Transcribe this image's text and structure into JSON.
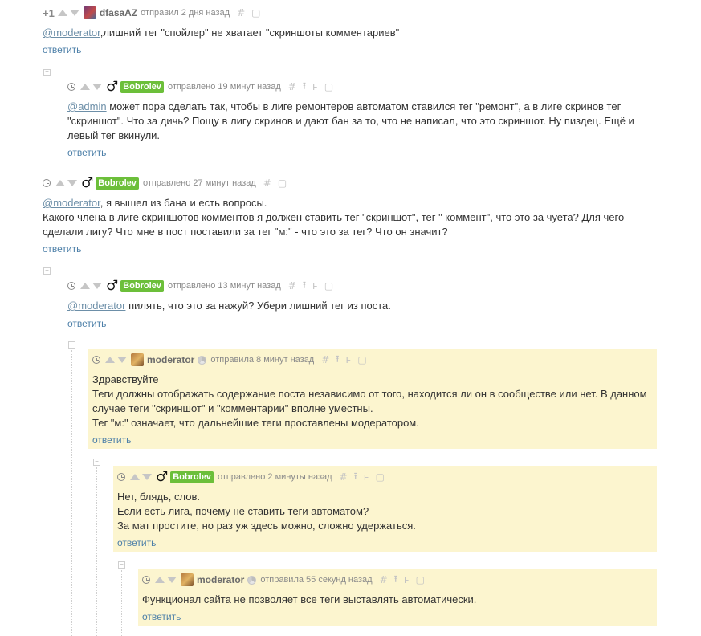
{
  "comments": [
    {
      "rating": "+1",
      "author": "dfasaAZ",
      "time": "отправил 2 дня назад",
      "icons": [
        "#",
        "▢"
      ],
      "mention": "@moderator",
      "lines": [
        ",лишний тег \"спойлер\" не хватает \"скриншоты комментариев\""
      ],
      "reply": "ответить"
    },
    {
      "author": "Bobrolev",
      "time": "отправлено 19 минут назад",
      "icons": [
        "#",
        "⭱",
        "ⱶ",
        "▢"
      ],
      "mention": "@admin",
      "lines": [
        " может пора сделать так, чтобы в лиге ремонтеров автоматом ставился тег \"ремонт\", а в лиге скринов тег",
        "\"скриншот\". Что за дичь? Пощу в лигу скринов и дают бан за то, что не написал, что это скриншот. Ну пиздец. Ещё и",
        "левый тег вкинули."
      ],
      "reply": "ответить"
    },
    {
      "author": "Bobrolev",
      "time": "отправлено 27 минут назад",
      "icons": [
        "#",
        "▢"
      ],
      "mention": "@moderator",
      "lines": [
        ", я вышел из бана и есть вопросы.",
        "Какого члена в лиге скриншотов комментов я должен ставить тег \"скриншот\", тег \" коммент\", что это за чуета? Для чего",
        "сделали лигу? Что мне в пост поставили за тег \"м:\" - что это за тег? Что он значит?"
      ],
      "reply": "ответить"
    },
    {
      "author": "Bobrolev",
      "time": "отправлено 13 минут назад",
      "icons": [
        "#",
        "⭱",
        "ⱶ",
        "▢"
      ],
      "mention": "@moderator",
      "lines": [
        " пилять, что это за нажуй? Убери лишний тег из поста."
      ],
      "reply": "ответить"
    },
    {
      "author": "moderator",
      "time": "отправила 8 минут назад",
      "icons": [
        "#",
        "⭱",
        "ⱶ",
        "▢"
      ],
      "lines": [
        "Здравствуйте",
        "Теги должны отображать содержание поста независимо от того, находится ли он в сообществе или нет. В данном",
        "случае теги \"скриншот\" и \"комментарии\" вполне уместны.",
        "Тег \"м:\" означает, что дальнейшие теги проставлены модератором."
      ],
      "reply": "ответить"
    },
    {
      "author": "Bobrolev",
      "time": "отправлено 2 минуты назад",
      "icons": [
        "#",
        "⭱",
        "ⱶ",
        "▢"
      ],
      "lines": [
        "Нет, блядь, слов.",
        "Если есть лига, почему не ставить теги автоматом?",
        "За мат простите, но раз уж здесь можно, сложно удержаться."
      ],
      "reply": "ответить"
    },
    {
      "author": "moderator",
      "time": "отправила 55 секунд назад",
      "icons": [
        "#",
        "⭱",
        "ⱶ",
        "▢"
      ],
      "lines": [
        "Функционал сайта не позволяет все теги выставлять автоматически."
      ],
      "reply": "ответить"
    }
  ],
  "collapse_symbol": "−",
  "colors": {
    "author_badge": "#6cbf3a",
    "highlight": "#fcf5cf",
    "link": "#4c7fa8",
    "mention": "#6d8fa8"
  }
}
